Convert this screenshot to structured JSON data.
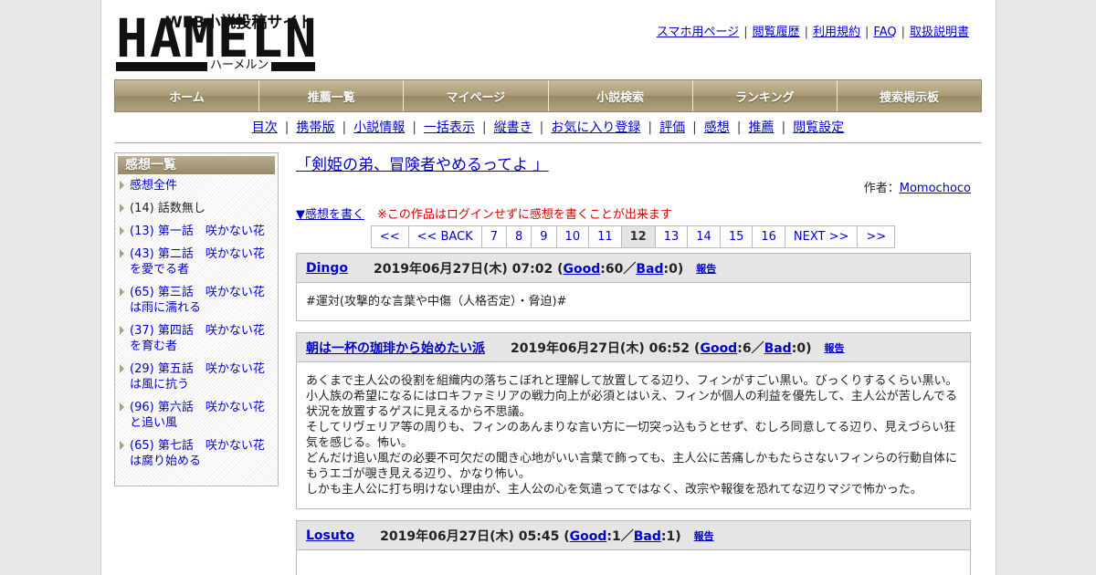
{
  "logo": {
    "main": "HAMELN",
    "tagline": "WEB小説投稿サイト",
    "kana": "ハーメルン"
  },
  "toplinks": [
    "スマホ用ページ",
    "閲覧履歴",
    "利用規約",
    "FAQ",
    "取扱説明書"
  ],
  "mainnav": [
    "ホーム",
    "推薦一覧",
    "マイページ",
    "小説検索",
    "ランキング",
    "捜索掲示板"
  ],
  "subnav": [
    "目次",
    "携帯版",
    "小説情報",
    "一括表示",
    "縦書き",
    "お気に入り登録",
    "評価",
    "感想",
    "推薦",
    "閲覧設定"
  ],
  "sidebar": {
    "title": "感想一覧",
    "items": [
      {
        "label": "感想全件",
        "link": true
      },
      {
        "label": "(14) 話数無し",
        "link": false
      },
      {
        "label": "(13) 第一話　咲かない花",
        "link": true
      },
      {
        "label": "(43) 第二話　咲かない花を愛でる者",
        "link": true
      },
      {
        "label": "(65) 第三話　咲かない花は雨に濡れる",
        "link": true
      },
      {
        "label": "(37) 第四話　咲かない花を育む者",
        "link": true
      },
      {
        "label": "(29) 第五話　咲かない花は風に抗う",
        "link": true
      },
      {
        "label": "(96) 第六話　咲かない花と追い風",
        "link": true
      },
      {
        "label": "(65) 第七話　咲かない花は腐り始める",
        "link": true
      }
    ]
  },
  "novel": {
    "title": "「剣姫の弟、冒険者やめるってよ 」",
    "author_label": "作者：",
    "author": "Momochoco"
  },
  "write": {
    "link": "▼感想を書く",
    "note": "※この作品はログインせずに感想を書くことが出来ます"
  },
  "pager": [
    "<<",
    "<< BACK",
    "7",
    "8",
    "9",
    "10",
    "11",
    "12",
    "13",
    "14",
    "15",
    "16",
    "NEXT >>",
    ">>"
  ],
  "pager_current": "12",
  "comments": [
    {
      "user": "Dingo",
      "date": "2019年06月27日(木) 07:02",
      "good": "60",
      "bad": "0",
      "report": "報告",
      "body": [
        "#運対(攻撃的な言葉や中傷（人格否定）・脅迫)#"
      ]
    },
    {
      "user": "朝は一杯の珈琲から始めたい派",
      "date": "2019年06月27日(木) 06:52",
      "good": "6",
      "bad": "0",
      "report": "報告",
      "body": [
        "あくまで主人公の役割を組織内の落ちこぼれと理解して放置してる辺り、フィンがすごい黒い。びっくりするくらい黒い。",
        "小人族の希望になるにはロキファミリアの戦力向上が必須とはいえ、フィンが個人の利益を優先して、主人公が苦しんでる状況を放置するゲスに見えるから不思議。",
        "そしてリヴェリア等の周りも、フィンのあんまりな言い方に一切突っ込もうとせず、むしろ同意してる辺り、見えづらい狂気を感じる。怖い。",
        "どんだけ追い風だの必要不可欠だの聞き心地がいい言葉で飾っても、主人公に苦痛しかもたらさないフィンらの行動自体にもうエゴが覗き見える辺り、かなり怖い。",
        "しかも主人公に打ち明けない理由が、主人公の心を気遣ってではなく、改宗や報復を恐れてな辺りマジで怖かった。"
      ]
    },
    {
      "user": "Losuto",
      "date": "2019年06月27日(木) 05:45",
      "good": "1",
      "bad": "1",
      "report": "報告",
      "body": []
    }
  ],
  "labels": {
    "good": "Good",
    "bad": "Bad",
    "slash": "／",
    "colon": ":",
    "open": " (",
    "close": ")"
  }
}
